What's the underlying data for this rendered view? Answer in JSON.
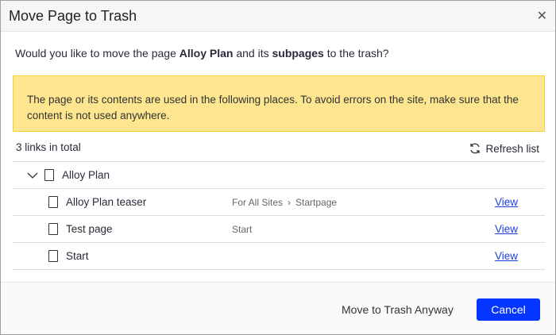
{
  "dialog": {
    "title": "Move Page to Trash",
    "close_icon": "close-icon"
  },
  "question": {
    "pre": "Would you like to move the page ",
    "page": "Alloy Plan",
    "mid": " and its ",
    "sub": "subpages",
    "post": " to the trash?"
  },
  "warning": "The page or its contents are used in the following places. To avoid errors on the site, make sure that the content is not used anywhere.",
  "links": {
    "count_label": "3 links in total",
    "refresh_label": "Refresh list",
    "root": {
      "name": "Alloy Plan"
    },
    "rows": [
      {
        "name": "Alloy Plan teaser",
        "icon": "block-icon",
        "path": [
          "For All Sites",
          "Startpage"
        ],
        "view": "View"
      },
      {
        "name": "Test page",
        "icon": "page-icon",
        "path": [
          "Start"
        ],
        "view": "View"
      },
      {
        "name": "Start",
        "icon": "page-icon",
        "path": [],
        "view": "View"
      }
    ]
  },
  "footer": {
    "trash_label": "Move to Trash Anyway",
    "cancel_label": "Cancel"
  },
  "colors": {
    "accent": "#0336ff",
    "warning_bg": "#fde68f",
    "link": "#1a3fe0"
  }
}
